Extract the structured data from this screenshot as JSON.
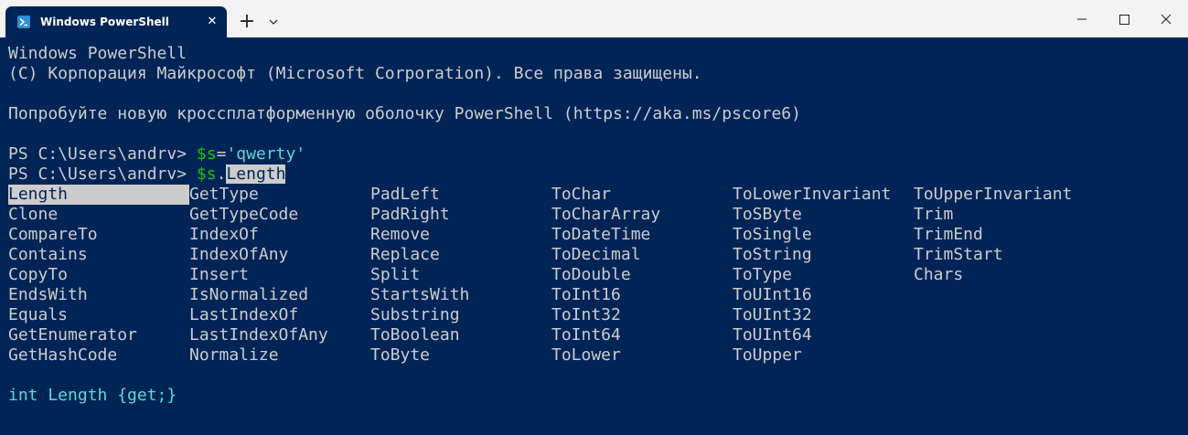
{
  "window": {
    "tab_title": "Windows PowerShell",
    "tab_icon": "powershell-icon",
    "close_tab_label": "✕",
    "new_tab_label": "+",
    "colors": {
      "terminal_bg": "#012456",
      "titlebar_bg": "#f3f3f3",
      "text": "#cccccc",
      "prompt_var": "#16c60c",
      "string": "#61d6d6",
      "highlight_bg": "#cccccc"
    }
  },
  "terminal": {
    "header1": "Windows PowerShell",
    "header2": "(C) Корпорация Майкрософт (Microsoft Corporation). Все права защищены.",
    "header3": "Попробуйте новую кроссплатформенную оболочку PowerShell (https://aka.ms/pscore6)",
    "prompt": "PS C:\\Users\\andrv> ",
    "cmd1": {
      "var": "$s",
      "op": "=",
      "value": "'qwerty'"
    },
    "cmd2": {
      "var": "$s",
      "dot": ".",
      "member": "Length"
    },
    "completions": [
      [
        "Length",
        "Clone",
        "CompareTo",
        "Contains",
        "CopyTo",
        "EndsWith",
        "Equals",
        "GetEnumerator",
        "GetHashCode"
      ],
      [
        "GetType",
        "GetTypeCode",
        "IndexOf",
        "IndexOfAny",
        "Insert",
        "IsNormalized",
        "LastIndexOf",
        "LastIndexOfAny",
        "Normalize"
      ],
      [
        "PadLeft",
        "PadRight",
        "Remove",
        "Replace",
        "Split",
        "StartsWith",
        "Substring",
        "ToBoolean",
        "ToByte"
      ],
      [
        "ToChar",
        "ToCharArray",
        "ToDateTime",
        "ToDecimal",
        "ToDouble",
        "ToInt16",
        "ToInt32",
        "ToInt64",
        "ToLower"
      ],
      [
        "ToLowerInvariant",
        "ToSByte",
        "ToSingle",
        "ToString",
        "ToType",
        "ToUInt16",
        "ToUInt32",
        "ToUInt64",
        "ToUpper"
      ],
      [
        "ToUpperInvariant",
        "Trim",
        "TrimEnd",
        "TrimStart",
        "Chars"
      ]
    ],
    "selected_completion": "Length",
    "tooltip": "int Length {get;}"
  }
}
